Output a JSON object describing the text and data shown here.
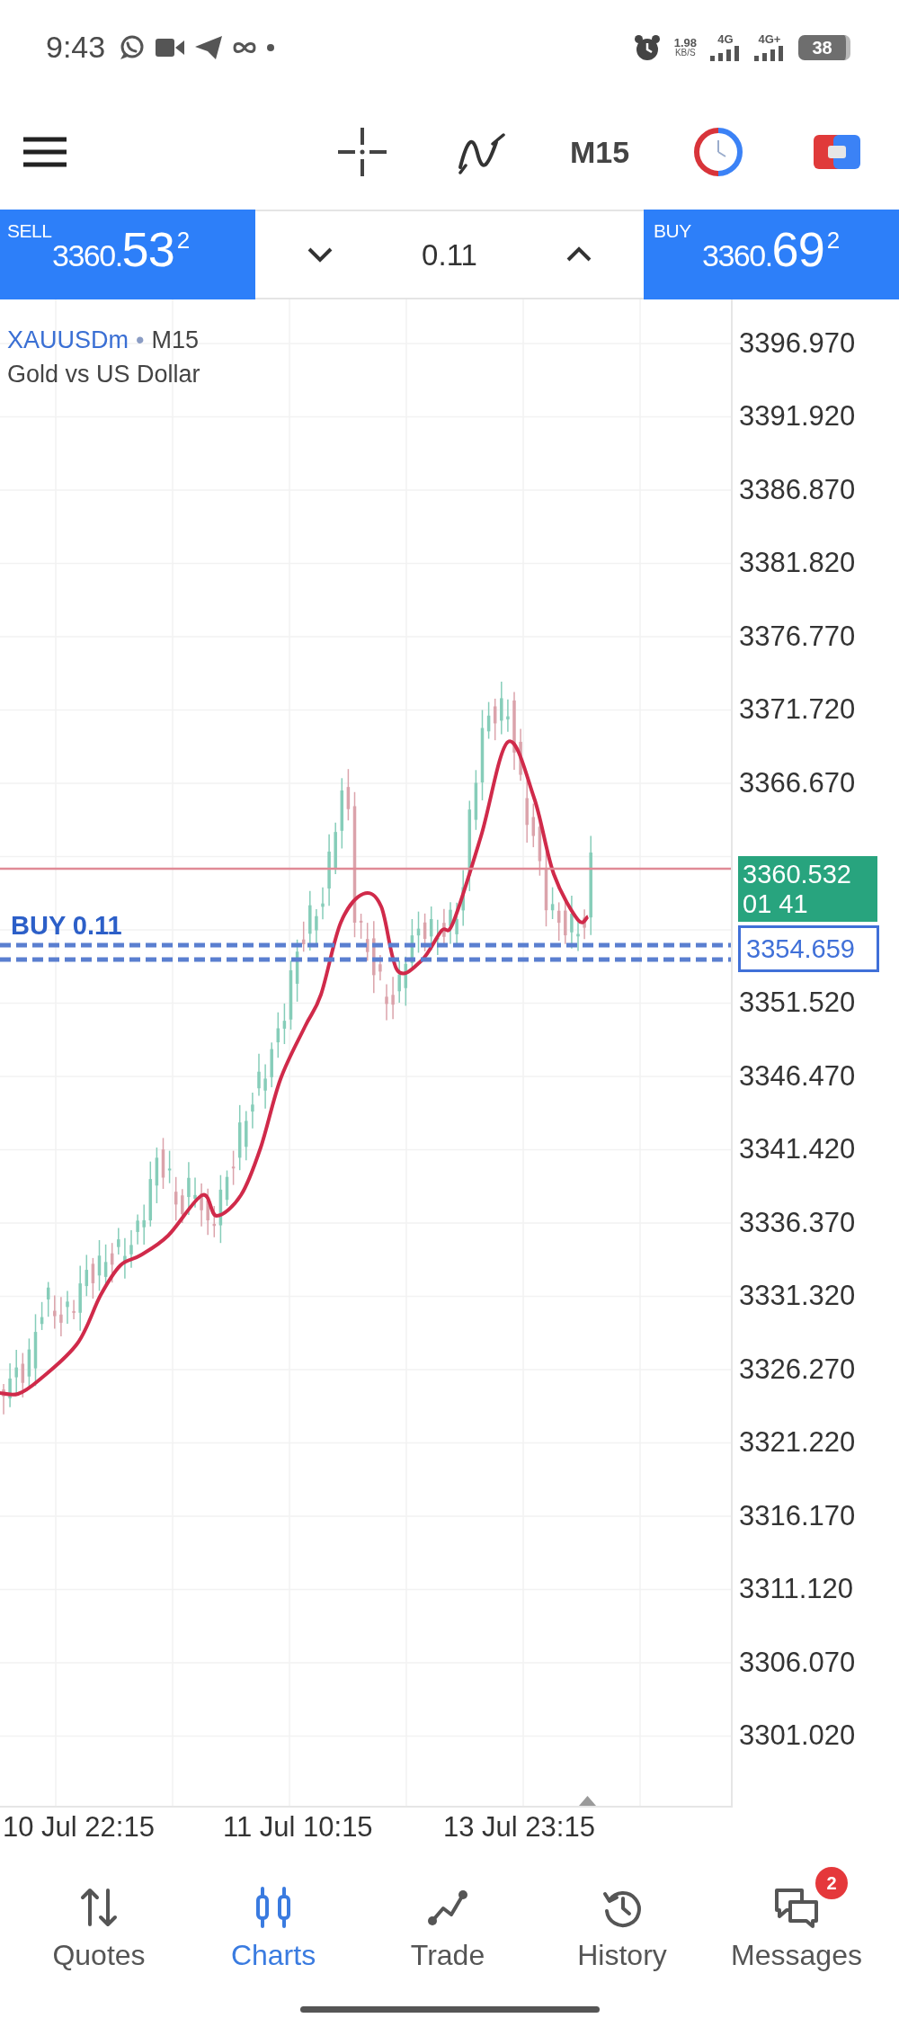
{
  "status_bar": {
    "time": "9:43",
    "network_speed": "1.98",
    "speed_unit": "KB/S",
    "networks": [
      "4G",
      "4G+"
    ],
    "battery": "38"
  },
  "toolbar": {
    "timeframe": "M15"
  },
  "trade_panel": {
    "sell": {
      "label": "SELL",
      "price": "3360.",
      "pips": "53",
      "point": "2"
    },
    "volume": "0.11",
    "buy": {
      "label": "BUY",
      "price": "3360.",
      "pips": "69",
      "point": "2"
    }
  },
  "chart": {
    "symbol": "XAUUSDm",
    "separator": "•",
    "timeframe": "M15",
    "description": "Gold vs US Dollar",
    "price_labels_upper": [
      "3396.970",
      "3391.920",
      "3386.870",
      "3381.820",
      "3376.770",
      "3371.720",
      "3366.670"
    ],
    "price_labels_lower": [
      "3351.520",
      "3346.470",
      "3341.420",
      "3336.370",
      "3331.320",
      "3326.270",
      "3321.220",
      "3316.170",
      "3311.120",
      "3306.070",
      "3301.020"
    ],
    "bid_price": "3360.532",
    "countdown": "01 41",
    "order_label": "BUY 0.11",
    "order_price": "3354.659",
    "time_labels": [
      "10 Jul 22:15",
      "11 Jul 10:15",
      "13 Jul 23:15"
    ]
  },
  "bottom_nav": [
    {
      "kind": "quotes",
      "label": "Quotes",
      "selected": false
    },
    {
      "kind": "charts",
      "label": "Charts",
      "selected": true
    },
    {
      "kind": "trade",
      "label": "Trade",
      "selected": false
    },
    {
      "kind": "history",
      "label": "History",
      "selected": false
    },
    {
      "kind": "messages",
      "label": "Messages",
      "selected": false,
      "badge": "2"
    }
  ]
}
